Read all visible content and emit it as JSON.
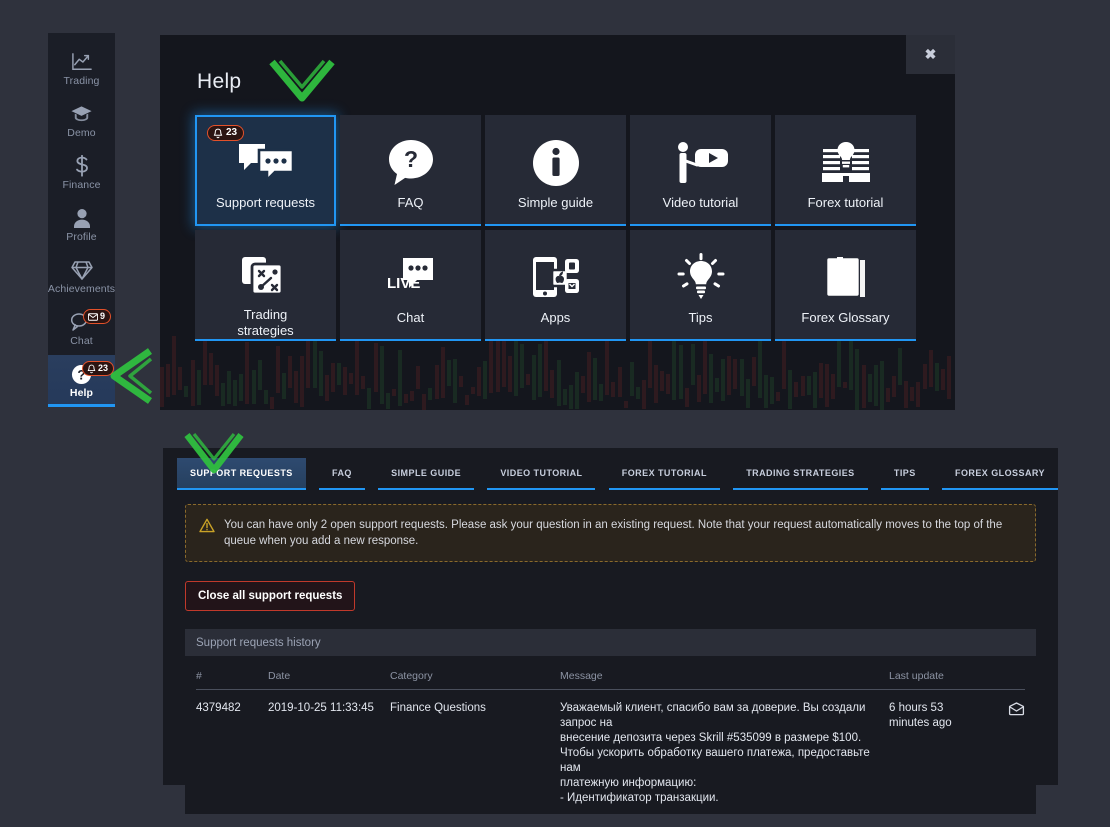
{
  "sidebar": {
    "items": [
      {
        "id": "trading",
        "label": "Trading",
        "icon": "chart-line-icon",
        "badge": null,
        "active": false
      },
      {
        "id": "demo",
        "label": "Demo",
        "icon": "graduation-cap-icon",
        "badge": null,
        "active": false
      },
      {
        "id": "finance",
        "label": "Finance",
        "icon": "dollar-icon",
        "badge": null,
        "active": false
      },
      {
        "id": "profile",
        "label": "Profile",
        "icon": "user-icon",
        "badge": null,
        "active": false
      },
      {
        "id": "achievements",
        "label": "Achievements",
        "icon": "diamond-icon",
        "badge": null,
        "active": false
      },
      {
        "id": "chat",
        "label": "Chat",
        "icon": "chat-bubble-icon",
        "badge": "9",
        "badge_icon": "envelope-icon",
        "active": false
      },
      {
        "id": "help",
        "label": "Help",
        "icon": "question-circle-icon",
        "badge": "23",
        "badge_icon": "bell-icon",
        "active": true
      }
    ]
  },
  "help_panel": {
    "title": "Help",
    "close_label": "✖",
    "tiles": [
      {
        "id": "support-requests",
        "label": "Support requests",
        "icon": "chat-bubbles-icon",
        "badge": "23",
        "badge_icon": "bell-icon",
        "selected": true
      },
      {
        "id": "faq",
        "label": "FAQ",
        "icon": "question-bubble-icon",
        "badge": null,
        "selected": false
      },
      {
        "id": "simple-guide",
        "label": "Simple guide",
        "icon": "info-circle-icon",
        "badge": null,
        "selected": false
      },
      {
        "id": "video-tutorial",
        "label": "Video tutorial",
        "icon": "presenter-video-icon",
        "badge": null,
        "selected": false
      },
      {
        "id": "forex-tutorial",
        "label": "Forex tutorial",
        "icon": "book-lightbulb-icon",
        "badge": null,
        "selected": false
      },
      {
        "id": "trading-strategies",
        "label": "Trading\nstrategies",
        "icon": "strategy-cards-icon",
        "badge": null,
        "selected": false
      },
      {
        "id": "chat",
        "label": "Chat",
        "icon": "live-chat-icon",
        "badge": null,
        "selected": false
      },
      {
        "id": "apps",
        "label": "Apps",
        "icon": "mobile-apps-icon",
        "badge": null,
        "selected": false
      },
      {
        "id": "tips",
        "label": "Tips",
        "icon": "lightbulb-icon",
        "badge": null,
        "selected": false
      },
      {
        "id": "forex-glossary",
        "label": "Forex Glossary",
        "icon": "book-az-icon",
        "badge": null,
        "selected": false
      }
    ]
  },
  "bottom_panel": {
    "tabs": [
      {
        "id": "support-requests",
        "label": "SUPPORT REQUESTS",
        "active": true
      },
      {
        "id": "faq",
        "label": "FAQ",
        "active": false
      },
      {
        "id": "simple-guide",
        "label": "SIMPLE GUIDE",
        "active": false
      },
      {
        "id": "video-tutorial",
        "label": "VIDEO TUTORIAL",
        "active": false
      },
      {
        "id": "forex-tutorial",
        "label": "FOREX TUTORIAL",
        "active": false
      },
      {
        "id": "trading-strategies",
        "label": "TRADING STRATEGIES",
        "active": false
      },
      {
        "id": "tips",
        "label": "TIPS",
        "active": false
      },
      {
        "id": "forex-glossary",
        "label": "FOREX GLOSSARY",
        "active": false
      }
    ],
    "notice": {
      "icon": "warning-triangle-icon",
      "text": "You can have only 2 open support requests. Please ask your question in an existing request. Note that your request automatically moves to the top of the queue when you add a new response."
    },
    "close_all_button": "Close all support requests",
    "history": {
      "section_title": "Support requests history",
      "columns": [
        "#",
        "Date",
        "Category",
        "Message",
        "Last update",
        ""
      ],
      "rows": [
        {
          "id": "4379482",
          "date": "2019-10-25 11:33:45",
          "category": "Finance Questions",
          "message_lines": [
            "Уважаемый клиент, спасибо вам за доверие. Вы создали запрос на",
            "внесение депозита через Skrill #535099 в размере $100.",
            "Чтобы ускорить обработку вашего платежа, предоставьте нам",
            "платежную информацию:",
            "- Идентификатор транзакции."
          ],
          "last_update": "6 hours 53\nminutes ago",
          "action_icon": "envelope-icon"
        }
      ]
    }
  },
  "annotations": {
    "arrows": [
      {
        "id": "arrow-help-title",
        "direction": "down",
        "color": "#2fbf3f"
      },
      {
        "id": "arrow-sidebar-help",
        "direction": "left",
        "color": "#2fbf3f"
      },
      {
        "id": "arrow-tab",
        "direction": "down",
        "color": "#2fbf3f"
      }
    ]
  },
  "colors": {
    "page_background": "#2f323d",
    "sidebar_background": "#1b1e27",
    "panel_background": "#14161d",
    "tile_background": "#262a36",
    "tile_selected_background": "#1d3048",
    "accent_blue": "#2196f3",
    "badge_border": "#e3512a",
    "danger_red": "#c0392b",
    "notice_border": "#8a6a2c",
    "arrow_green": "#2fbf3f"
  }
}
